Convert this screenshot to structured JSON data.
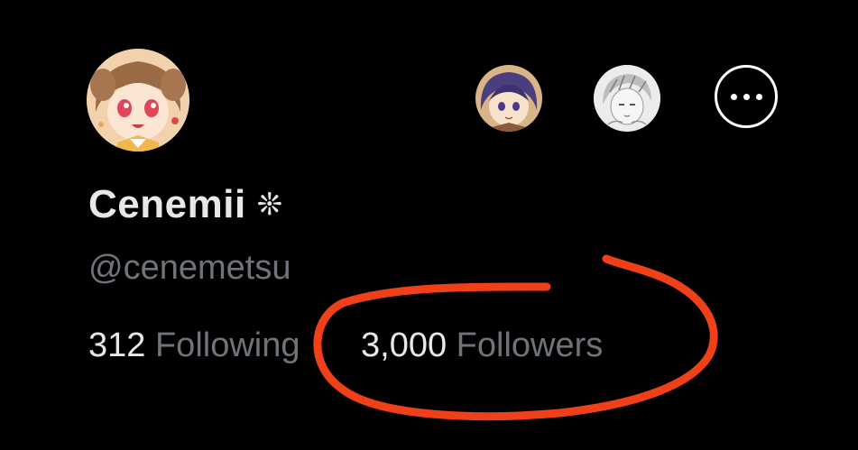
{
  "profile": {
    "display_name": "Cenemii",
    "name_badge": "❊",
    "handle": "@cenemetsu",
    "avatar": "avatar-anime-girl",
    "mutual_avatars": [
      "avatar-purple-hair",
      "avatar-sketch"
    ],
    "more_icon": "ellipsis-icon"
  },
  "stats": {
    "following_count": "312",
    "following_label": "Following",
    "followers_count": "3,000",
    "followers_label": "Followers"
  },
  "annotation": {
    "type": "hand-drawn circle",
    "color": "#f0401a",
    "target": "followers"
  },
  "colors": {
    "background": "#000000",
    "primary_text": "#e8e8e8",
    "secondary_text": "#6e7479"
  }
}
